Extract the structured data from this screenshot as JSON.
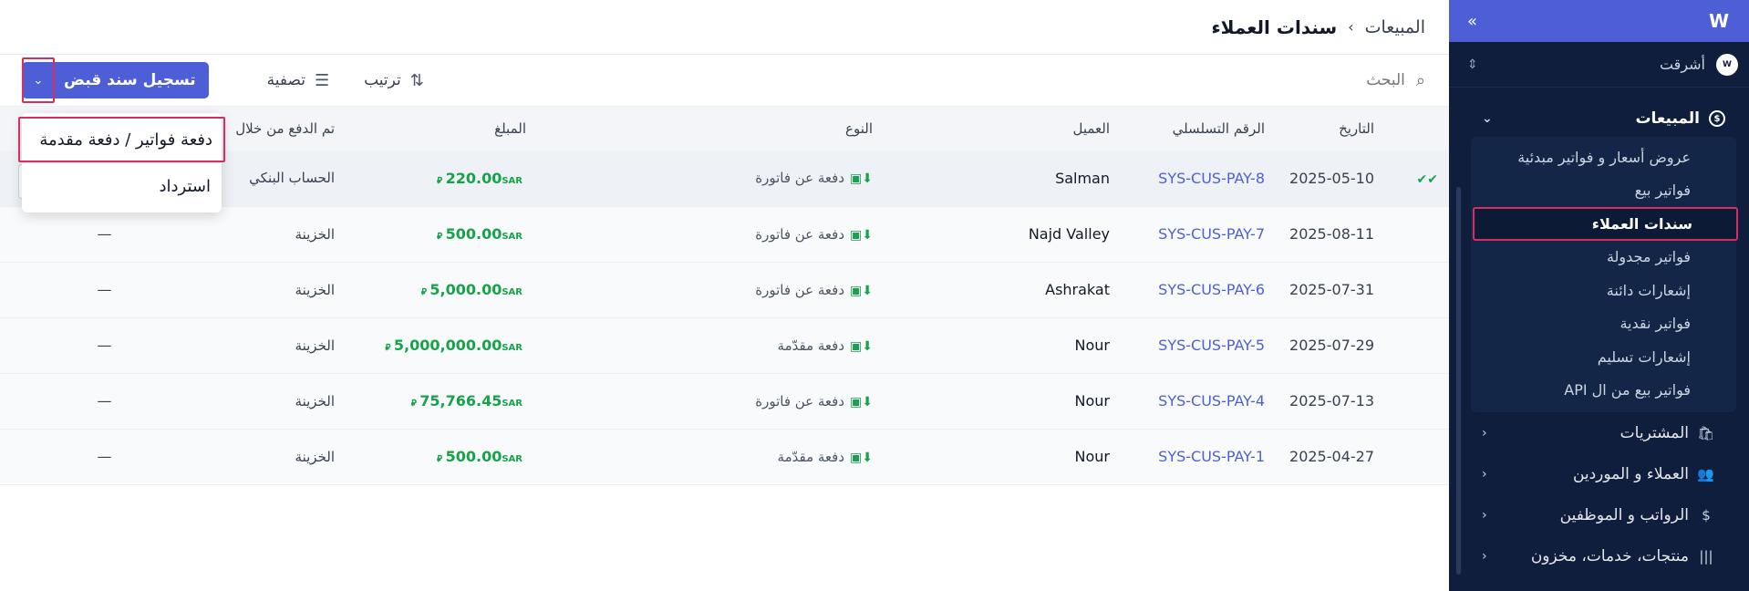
{
  "sidebar": {
    "org_name": "أشرقت",
    "org_avatar": "W",
    "section": {
      "label": "المبيعات",
      "items": [
        {
          "label": "عروض أسعار و فواتير مبدئية"
        },
        {
          "label": "فواتير بيع"
        },
        {
          "label": "سندات العملاء"
        },
        {
          "label": "فواتير مجدولة"
        },
        {
          "label": "إشعارات دائنة"
        },
        {
          "label": "فواتير نقدية"
        },
        {
          "label": "إشعارات تسليم"
        },
        {
          "label": "فواتير بيع من ال API"
        }
      ]
    },
    "nav": [
      {
        "label": "المشتريات",
        "icon": "shopping-bag-icon"
      },
      {
        "label": "العملاء و الموردين",
        "icon": "users-icon"
      },
      {
        "label": "الرواتب و الموظفين",
        "icon": "payroll-icon"
      },
      {
        "label": "منتجات، خدمات، مخزون",
        "icon": "barcode-icon"
      }
    ]
  },
  "header": {
    "parent": "المبيعات",
    "current": "سندات العملاء"
  },
  "toolbar": {
    "search_placeholder": "البحث",
    "sort_label": "ترتيب",
    "filter_label": "تصفية",
    "primary_label": "تسجيل سند قبض"
  },
  "menu": {
    "items": [
      "دفعة فواتير / دفعة مقدمة",
      "استرداد"
    ]
  },
  "table": {
    "headers": {
      "date": "التاريخ",
      "serial": "الرقم التسلسلي",
      "customer": "العميل",
      "type": "النوع",
      "amount": "المبلغ",
      "paid_via": "تم الدفع من خلال"
    },
    "currency": "SAR ⃁",
    "rows": [
      {
        "date": "2025-05-10",
        "serial": "SYS-CUS-PAY-8",
        "customer": "Salman",
        "type": "دفعة عن فاتورة",
        "amount": "220.00",
        "paid_via": "الحساب البنكي",
        "extra": ""
      },
      {
        "date": "2025-08-11",
        "serial": "SYS-CUS-PAY-7",
        "customer": "Najd Valley",
        "type": "دفعة عن فاتورة",
        "amount": "500.00",
        "paid_via": "الخزينة",
        "extra": "—"
      },
      {
        "date": "2025-07-31",
        "serial": "SYS-CUS-PAY-6",
        "customer": "Ashrakat",
        "type": "دفعة عن فاتورة",
        "amount": "5,000.00",
        "paid_via": "الخزينة",
        "extra": "—"
      },
      {
        "date": "2025-07-29",
        "serial": "SYS-CUS-PAY-5",
        "customer": "Nour",
        "type": "دفعة مقدّمة",
        "amount": "5,000,000.00",
        "paid_via": "الخزينة",
        "extra": "—"
      },
      {
        "date": "2025-07-13",
        "serial": "SYS-CUS-PAY-4",
        "customer": "Nour",
        "type": "دفعة عن فاتورة",
        "amount": "75,766.45",
        "paid_via": "الخزينة",
        "extra": "—"
      },
      {
        "date": "2025-04-27",
        "serial": "SYS-CUS-PAY-1",
        "customer": "Nour",
        "type": "دفعة مقدّمة",
        "amount": "500.00",
        "paid_via": "الخزينة",
        "extra": "—"
      }
    ]
  },
  "colors": {
    "accent": "#4d5ed6",
    "sidebar_bg": "#0f1e3d",
    "highlight": "#d62e63",
    "amount": "#16a34a"
  }
}
